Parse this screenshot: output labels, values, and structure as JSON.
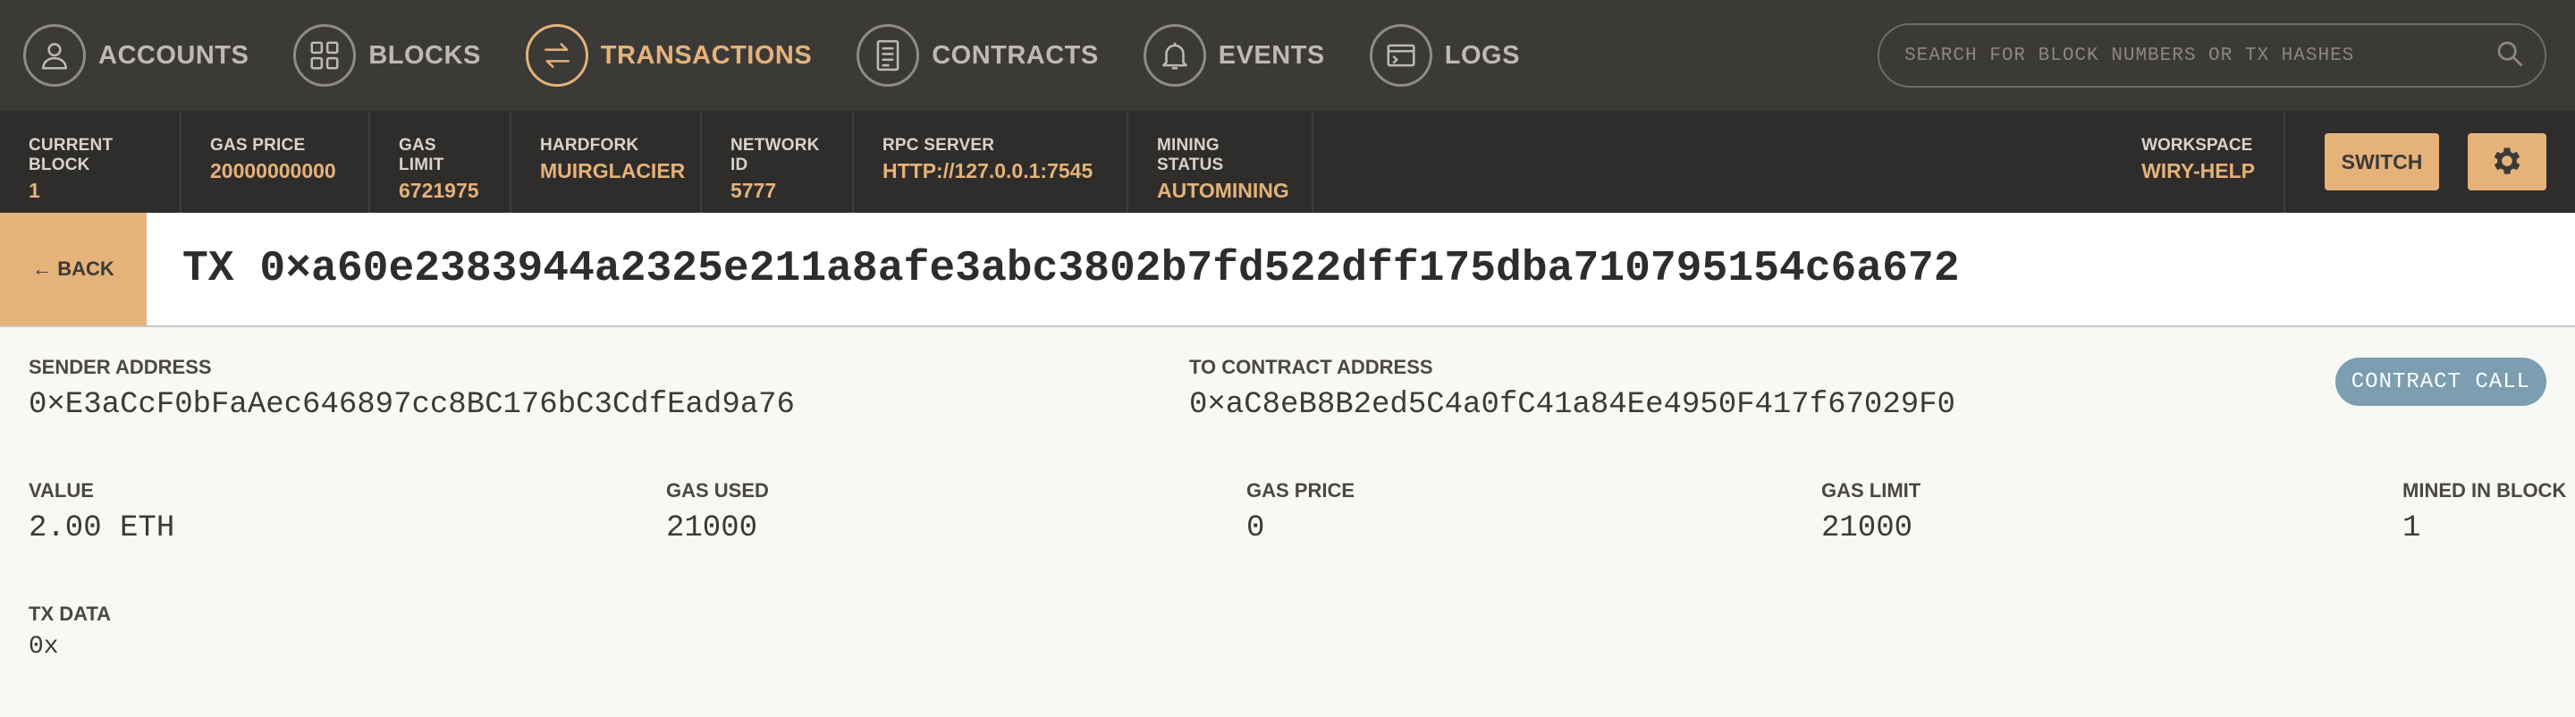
{
  "nav": {
    "items": [
      {
        "label": "ACCOUNTS",
        "icon": "user-icon"
      },
      {
        "label": "BLOCKS",
        "icon": "grid-icon"
      },
      {
        "label": "TRANSACTIONS",
        "icon": "swap-arrows-icon"
      },
      {
        "label": "CONTRACTS",
        "icon": "document-icon"
      },
      {
        "label": "EVENTS",
        "icon": "bell-icon"
      },
      {
        "label": "LOGS",
        "icon": "terminal-icon"
      }
    ],
    "active": "TRANSACTIONS",
    "search_placeholder": "SEARCH FOR BLOCK NUMBERS OR TX HASHES"
  },
  "status": {
    "current_block": {
      "label": "CURRENT BLOCK",
      "value": "1"
    },
    "gas_price": {
      "label": "GAS PRICE",
      "value": "20000000000"
    },
    "gas_limit": {
      "label": "GAS LIMIT",
      "value": "6721975"
    },
    "hardfork": {
      "label": "HARDFORK",
      "value": "MUIRGLACIER"
    },
    "network_id": {
      "label": "NETWORK ID",
      "value": "5777"
    },
    "rpc_server": {
      "label": "RPC SERVER",
      "value": "HTTP://127.0.0.1:7545"
    },
    "mining_status": {
      "label": "MINING STATUS",
      "value": "AUTOMINING"
    },
    "workspace": {
      "label": "WORKSPACE",
      "value": "WIRY-HELP"
    },
    "switch_label": "SWITCH"
  },
  "tx": {
    "back_label": "← BACK",
    "title": "TX 0×a60e2383944a2325e211a8afe3abc3802b7fd522dff175dba710795154c6a672",
    "sender": {
      "label": "SENDER ADDRESS",
      "value": "0×E3aCcF0bFaAec646897cc8BC176bC3CdfEad9a76"
    },
    "to_contract": {
      "label": "TO CONTRACT ADDRESS",
      "value": "0×aC8eB8B2ed5C4a0fC41a84Ee4950F417f67029F0"
    },
    "badge": "CONTRACT CALL",
    "value": {
      "label": "VALUE",
      "value": "2.00 ETH"
    },
    "gas_used": {
      "label": "GAS USED",
      "value": "21000"
    },
    "gas_price": {
      "label": "GAS PRICE",
      "value": "0"
    },
    "gas_limit": {
      "label": "GAS LIMIT",
      "value": "21000"
    },
    "mined_in_block": {
      "label": "MINED IN BLOCK",
      "value": "1"
    },
    "tx_data": {
      "label": "TX DATA",
      "value": "0x"
    }
  },
  "colors": {
    "accent": "#e5b27a",
    "nav_bg": "#3c3a37",
    "status_bg": "#2f2d2b",
    "badge_bg": "#7b9eb1"
  }
}
